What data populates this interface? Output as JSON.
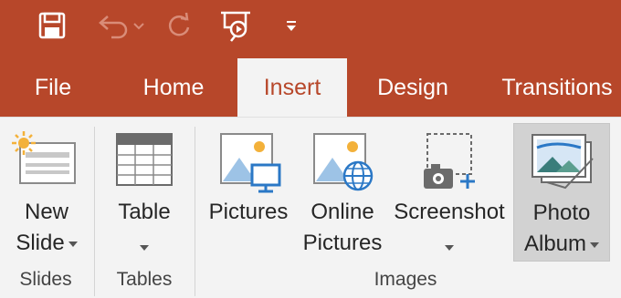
{
  "quick_access": {
    "save_icon": "save-icon",
    "undo_icon": "undo-icon",
    "redo_icon": "redo-icon",
    "present_icon": "start-from-beginning-icon",
    "customize_icon": "customize-dropdown-icon"
  },
  "tabs": [
    {
      "label": "File"
    },
    {
      "label": "Home"
    },
    {
      "label": "Insert"
    },
    {
      "label": "Design"
    },
    {
      "label": "Transitions"
    }
  ],
  "ribbon": {
    "new_slide": {
      "line1": "New",
      "line2": "Slide"
    },
    "table": {
      "label": "Table"
    },
    "pictures": {
      "label": "Pictures"
    },
    "online_pictures": {
      "line1": "Online",
      "line2": "Pictures"
    },
    "screenshot": {
      "label": "Screenshot"
    },
    "photo_album": {
      "line1": "Photo",
      "line2": "Album"
    },
    "groups": {
      "slides": "Slides",
      "tables": "Tables",
      "images": "Images"
    }
  },
  "colors": {
    "accent": "#b7472a",
    "ribbon_bg": "#f3f3f3"
  }
}
